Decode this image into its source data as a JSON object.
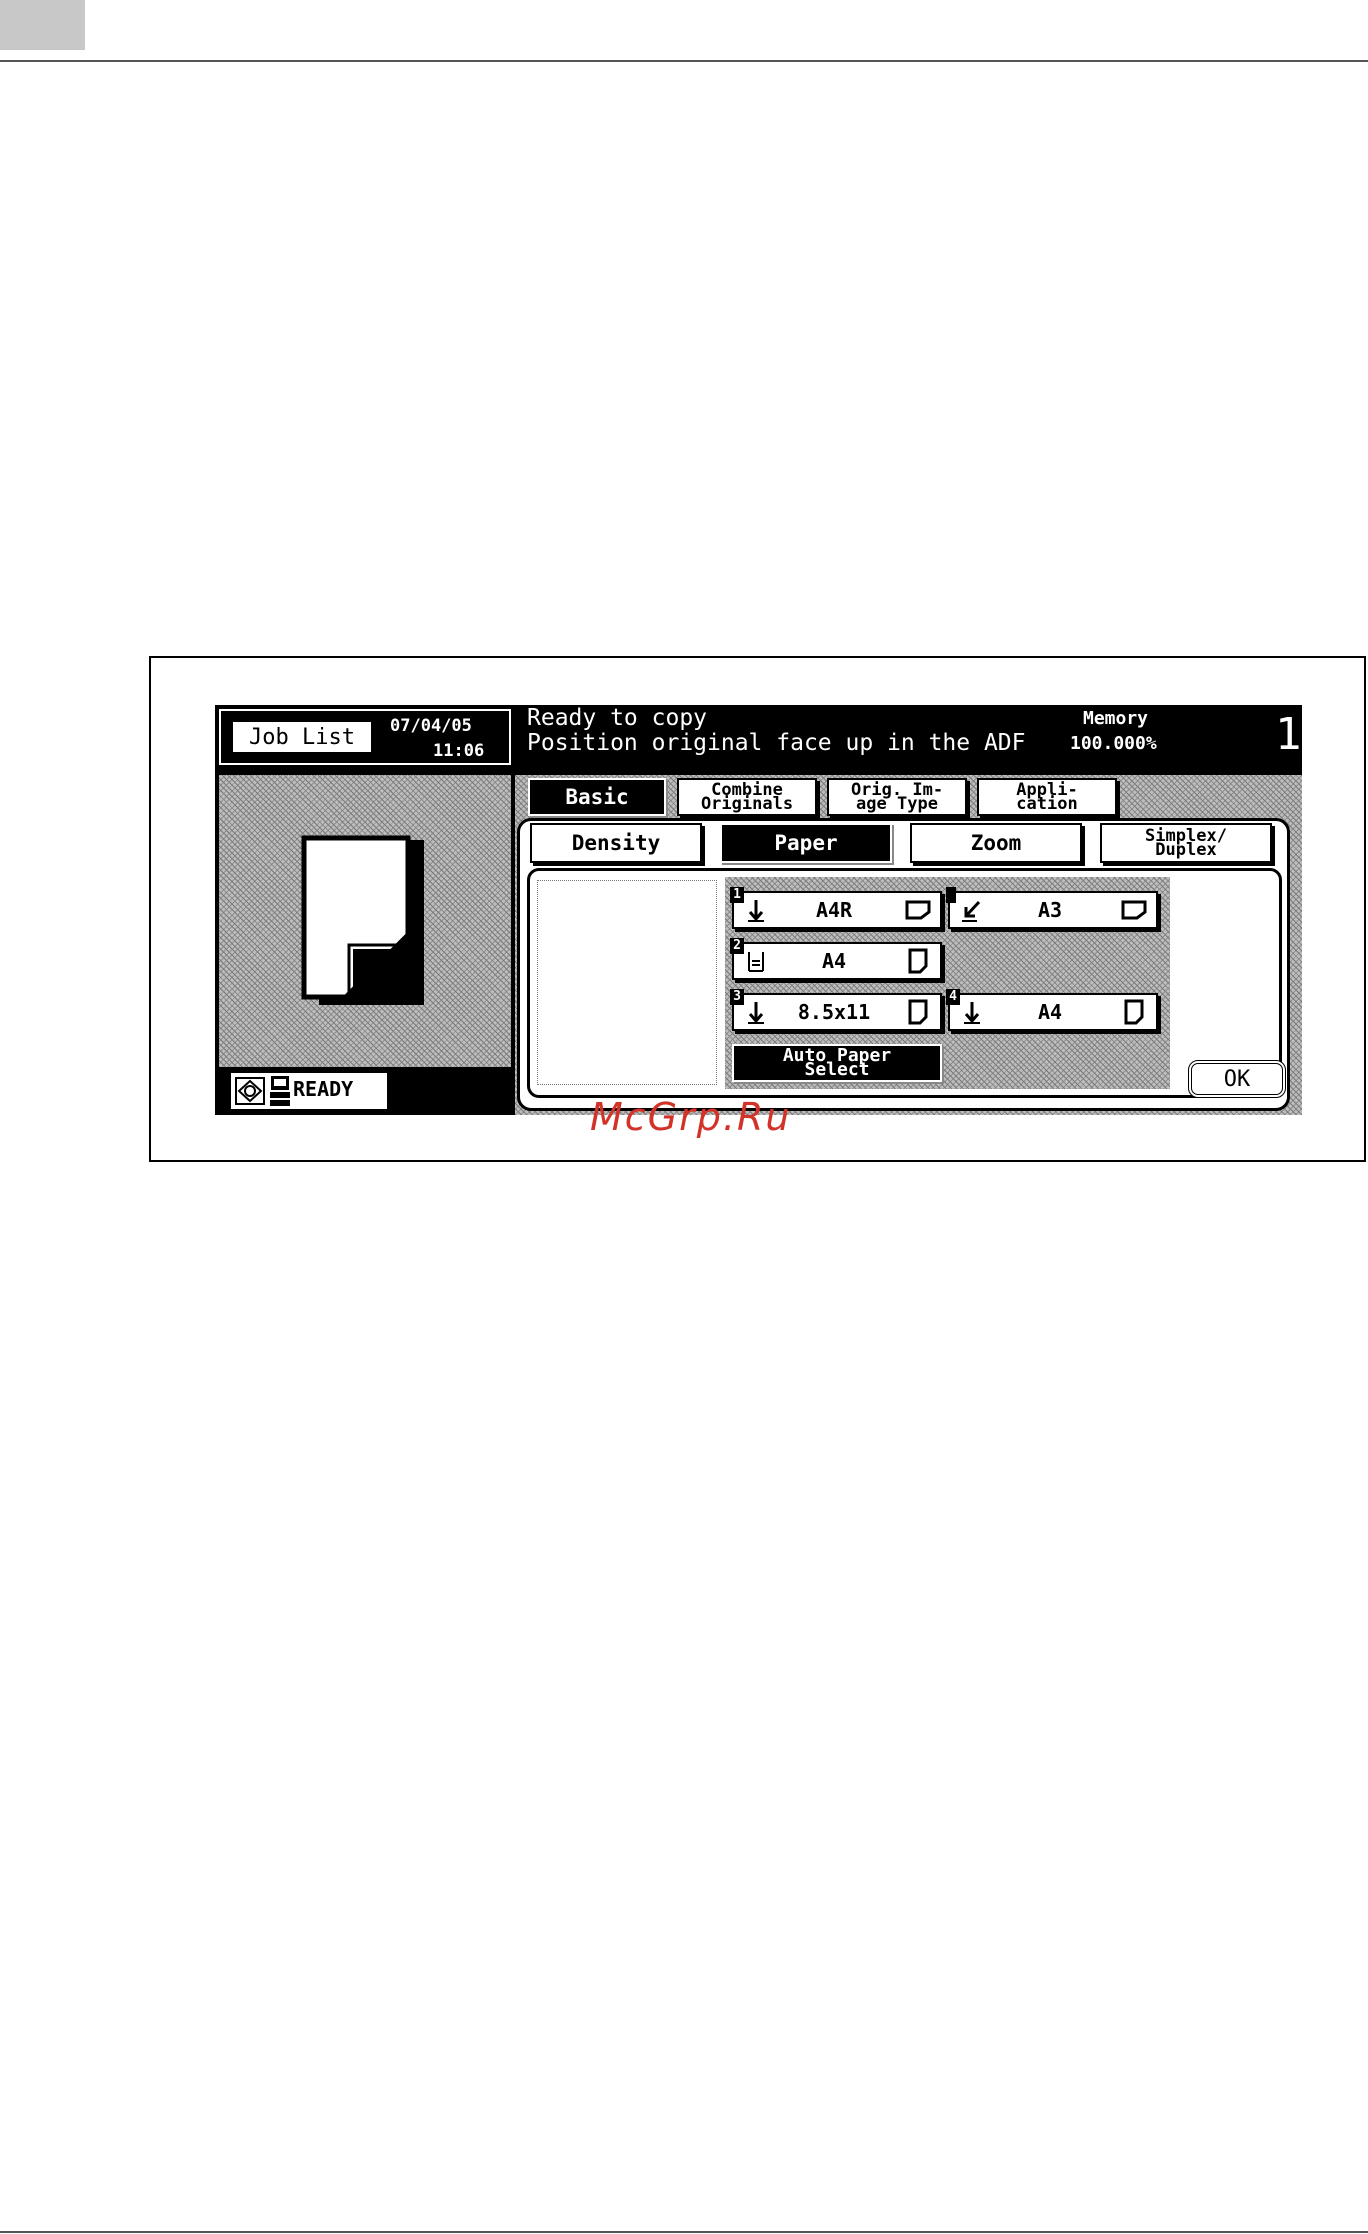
{
  "header": {
    "accent": "#c8c8c8"
  },
  "watermark": {
    "text": "McGrp.Ru",
    "color": "#d23228"
  },
  "status_bar": {
    "job_list_label": "Job List",
    "date": "07/04/05",
    "time": "11:06",
    "message_line1": "Ready to copy",
    "message_line2": "Position original face up in the ADF",
    "memory_label": "Memory",
    "memory_value": "100.000%",
    "copies": "1",
    "ready_label": "READY"
  },
  "main_tabs": [
    {
      "label": "Basic",
      "selected": true
    },
    {
      "label": "Combine\nOriginals",
      "selected": false
    },
    {
      "label": "Orig. Im-\nage Type",
      "selected": false
    },
    {
      "label": "Appli-\ncation",
      "selected": false
    }
  ],
  "sub_tabs": [
    {
      "label": "Density",
      "selected": false
    },
    {
      "label": "Paper",
      "selected": true
    },
    {
      "label": "Zoom",
      "selected": false
    },
    {
      "label": "Simplex/\nDuplex",
      "selected": false
    }
  ],
  "trays": [
    {
      "number": "1",
      "feed_icon": "down-arrow-icon",
      "size": "A4R",
      "orientation_icon": "landscape-paper-icon"
    },
    {
      "number": "2",
      "feed_icon": "tray-stack-icon",
      "size": "A4",
      "orientation_icon": "portrait-paper-icon"
    },
    {
      "number": "3",
      "feed_icon": "down-arrow-icon",
      "size": "8.5x11",
      "orientation_icon": "portrait-paper-icon"
    },
    {
      "number": "",
      "feed_icon": "bypass-arrow-icon",
      "size": "A3",
      "orientation_icon": "landscape-paper-icon"
    },
    {
      "number": "4",
      "feed_icon": "down-arrow-icon",
      "size": "A4",
      "orientation_icon": "portrait-paper-icon"
    }
  ],
  "auto_paper_label": "Auto Paper\nSelect",
  "ok_label": "OK"
}
